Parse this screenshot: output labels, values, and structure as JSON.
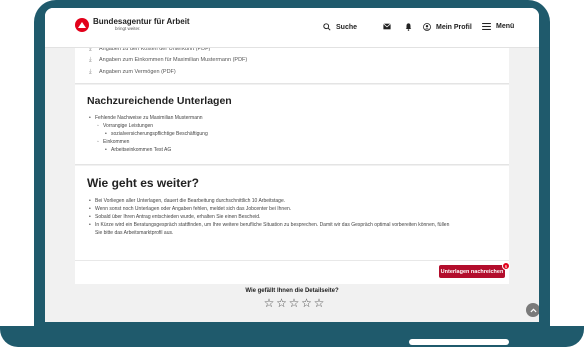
{
  "header": {
    "logo_name": "Bundesagentur für Arbeit",
    "logo_tagline": "bringt weiter.",
    "search_label": "Suche",
    "profile_label": "Mein Profil",
    "menu_label": "Menü"
  },
  "documents": {
    "items": [
      "Angaben zu den Kosten der Unterkunft (PDF)",
      "Angaben zum Einkommen für Maximilian Mustermann (PDF)",
      "Angaben zum Vermögen (PDF)"
    ]
  },
  "missing": {
    "title": "Nachzureichende Unterlagen",
    "item1": "Fehlende Nachweise zu Maximilian Mustermann",
    "item1_sub1": "Vorrangige Leistungen",
    "item1_sub1_a": "sozialversicherungspflichtige Beschäftigung",
    "item1_sub2": "Einkommen",
    "item1_sub2_a": "Arbeitseinkommen Test AG"
  },
  "next": {
    "title": "Wie geht es weiter?",
    "items": [
      "Bei Vorliegen aller Unterlagen, dauert die Bearbeitung durchschnittlich 10 Arbeitstage.",
      "Wenn sonst noch Unterlagen oder Angaben fehlen, meldet sich das Jobcenter bei Ihnen.",
      "Sobald über Ihren Antrag entschieden wurde, erhalten Sie einen Bescheid.",
      "In Kürze wird ein Beratungsgespräch stattfinden, um Ihre weitere berufliche Situation zu besprechen. Damit wir das Gespräch optimal vorbereiten können, füllen",
      "Sie bitte das Arbeitsmarktprofil aus."
    ],
    "upload_button": "Unterlagen nachreichen",
    "upload_badge": "6"
  },
  "feedback": {
    "question": "Wie gefällt Ihnen die Detailseite?",
    "star_glyph": "☆",
    "rating": 0,
    "max_rating": 5
  },
  "colors": {
    "brand_red": "#e2001a",
    "button_red": "#b30d2c",
    "frame": "#1f5a6c"
  }
}
